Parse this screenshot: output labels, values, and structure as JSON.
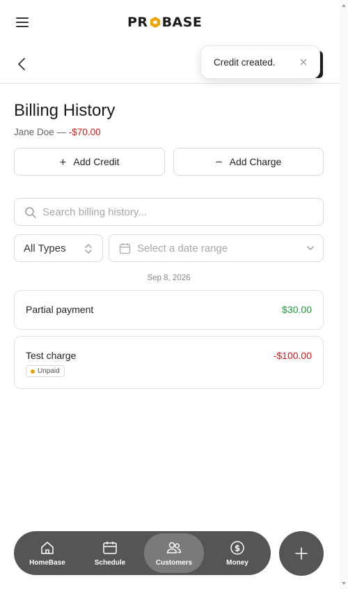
{
  "brand": {
    "logo_text_left": "PR",
    "logo_text_right": "BASE",
    "logo_accent": "#f0a500"
  },
  "toast": {
    "message": "Credit created."
  },
  "page": {
    "title": "Billing History",
    "customer_name": "Jane Doe — ",
    "balance": "-$70.00"
  },
  "actions": {
    "add_credit_label": "Add Credit",
    "add_charge_label": "Add Charge"
  },
  "search": {
    "placeholder": "Search billing history..."
  },
  "filters": {
    "type_selected": "All Types",
    "date_placeholder": "Select a date range"
  },
  "history": {
    "date_header": "Sep 8, 2026",
    "entries": [
      {
        "title": "Partial payment",
        "amount": "$30.00"
      },
      {
        "title": "Test charge",
        "amount": "-$100.00",
        "badge": "Unpaid"
      }
    ]
  },
  "nav": {
    "items": [
      {
        "label": "HomeBase",
        "icon": "home-icon"
      },
      {
        "label": "Schedule",
        "icon": "calendar-icon"
      },
      {
        "label": "Customers",
        "icon": "users-icon",
        "active": true
      },
      {
        "label": "Money",
        "icon": "dollar-icon"
      }
    ]
  },
  "colors": {
    "positive": "#1e9a3d",
    "negative": "#d11a1a",
    "nav_bg": "#555555",
    "badge_dot": "#f0a200"
  }
}
